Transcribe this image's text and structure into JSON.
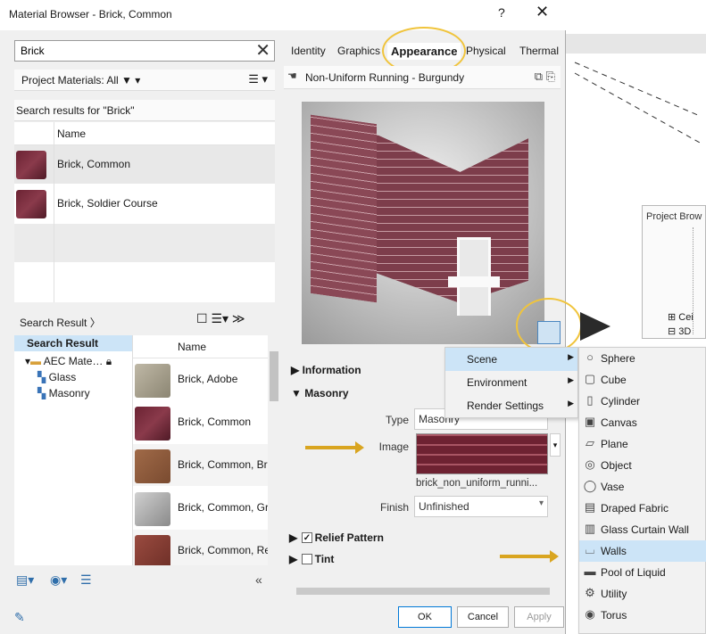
{
  "window": {
    "title": "Material Browser - Brick, Common",
    "help": "?",
    "close": "✕"
  },
  "search": {
    "value": "Brick",
    "placeholder": "",
    "clear": "✕"
  },
  "project_materials": {
    "label": "Project Materials: All",
    "filter_icon": "▼",
    "view_icon": "☰"
  },
  "results_header": "Search results for \"Brick\"",
  "top_list": {
    "col_name": "Name",
    "rows": [
      {
        "name": "Brick, Common",
        "thumb": "brick"
      },
      {
        "name": "Brick, Soldier Course",
        "thumb": "brick"
      }
    ]
  },
  "library_bar": {
    "crumb": "Search Result",
    "tools": "☐  ☰▾  ≫"
  },
  "tree": {
    "root": "Search Result",
    "folder": "AEC Mate…",
    "children": [
      "Glass",
      "Masonry"
    ]
  },
  "lib_list": {
    "col_name": "Name",
    "rows": [
      {
        "name": "Brick, Adobe",
        "thumb": "beige"
      },
      {
        "name": "Brick, Common",
        "thumb": "brick"
      },
      {
        "name": "Brick, Common, Br",
        "thumb": "tan"
      },
      {
        "name": "Brick, Common, Gr",
        "thumb": "grey"
      },
      {
        "name": "Brick, Common, Re",
        "thumb": "red"
      }
    ]
  },
  "tabs": [
    "Identity",
    "Graphics",
    "Appearance",
    "Physical",
    "Thermal"
  ],
  "asset": {
    "name": "Non-Uniform Running - Burgundy",
    "icons": "⧉ ⎘"
  },
  "props": {
    "information": "Information",
    "masonry": "Masonry",
    "type_label": "Type",
    "type_value": "Masonry",
    "image_label": "Image",
    "image_file": "brick_non_uniform_runni...",
    "finish_label": "Finish",
    "finish_value": "Unfinished",
    "relief": "Relief Pattern",
    "relief_check": "✓",
    "tint": "Tint",
    "expand": "▶",
    "collapse": "▼"
  },
  "buttons": {
    "ok": "OK",
    "cancel": "Cancel",
    "apply": "Apply"
  },
  "context_menu": [
    {
      "label": "Scene",
      "arrow": "▶"
    },
    {
      "label": "Environment",
      "arrow": "▶"
    },
    {
      "label": "Render Settings",
      "arrow": "▶"
    }
  ],
  "submenu": [
    {
      "label": "Sphere",
      "icon": "○"
    },
    {
      "label": "Cube",
      "icon": "▢"
    },
    {
      "label": "Cylinder",
      "icon": "▯"
    },
    {
      "label": "Canvas",
      "icon": "▣"
    },
    {
      "label": "Plane",
      "icon": "▱"
    },
    {
      "label": "Object",
      "icon": "◎"
    },
    {
      "label": "Vase",
      "icon": "◯"
    },
    {
      "label": "Draped Fabric",
      "icon": "▤"
    },
    {
      "label": "Glass Curtain Wall",
      "icon": "▥"
    },
    {
      "label": "Walls",
      "icon": "⌴"
    },
    {
      "label": "Pool of Liquid",
      "icon": "▬"
    },
    {
      "label": "Utility",
      "icon": "⚙"
    },
    {
      "label": "Torus",
      "icon": "◉"
    }
  ],
  "project_browser": {
    "title": "Project Brow",
    "items": [
      "Cei",
      "3D"
    ]
  },
  "colors": {
    "highlight": "#cce4f7",
    "annotation": "#f0c43c",
    "arrow": "#d9a520"
  }
}
